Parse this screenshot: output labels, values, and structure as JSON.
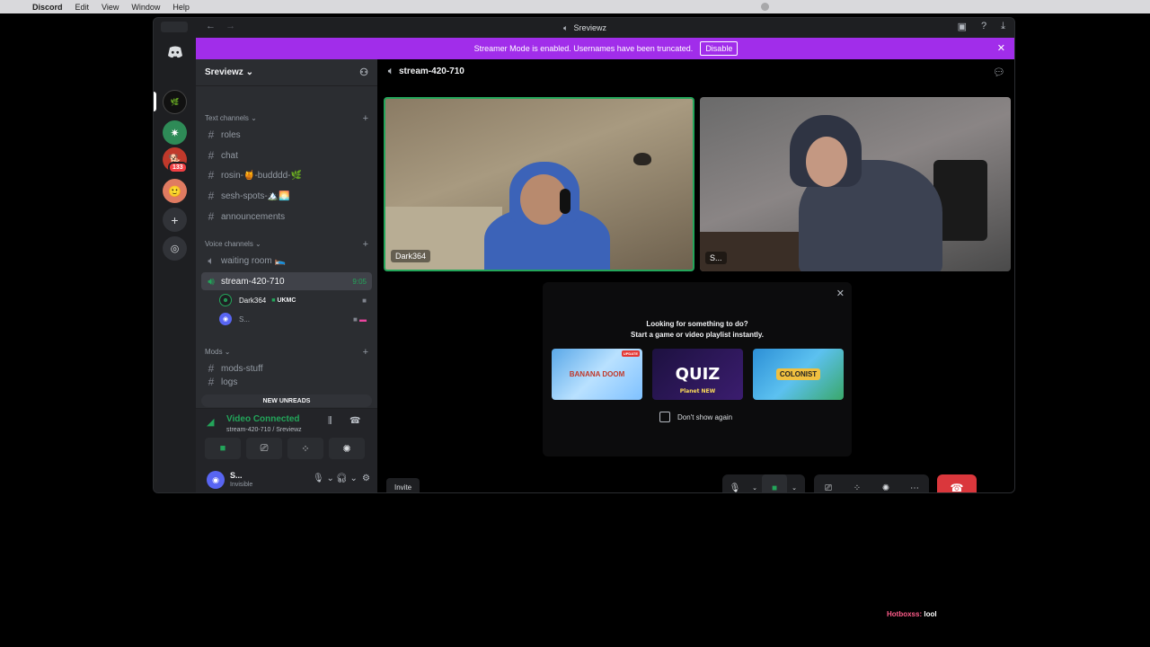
{
  "menubar": {
    "apple": "",
    "app": "Discord",
    "items": [
      "Edit",
      "View",
      "Window",
      "Help"
    ]
  },
  "window": {
    "title": "Sreviewz"
  },
  "banner": {
    "text": "Streamer Mode is enabled. Usernames have been truncated.",
    "button": "Disable",
    "close": "✕"
  },
  "servers": {
    "badge": "133"
  },
  "guild": {
    "name": "Sreviewz ⌄"
  },
  "categories": {
    "text": "Text channels ⌄",
    "voice": "Voice channels ⌄",
    "mods": "Mods ⌄"
  },
  "text_channels": [
    "roles",
    "chat",
    "rosin-🍯-budddd-🌿",
    "sesh-spots-🏔️🌅",
    "announcements"
  ],
  "voice_channels": [
    {
      "name": "waiting room 🛌"
    },
    {
      "name": "stream-420-710",
      "time": "9:05"
    }
  ],
  "members": [
    {
      "name": "Dark364",
      "tag": "UKMC"
    },
    {
      "name": "S..."
    }
  ],
  "mods_channels": [
    "mods-stuff",
    "logs"
  ],
  "new_unreads": "NEW UNREADS",
  "voice_panel": {
    "title": "Video Connected",
    "subtitle": "stream-420-710 / Sreviewz"
  },
  "user": {
    "name": "S...",
    "status": "Invisible"
  },
  "main": {
    "channel": "stream-420-710"
  },
  "tiles": [
    {
      "name": "Dark364"
    },
    {
      "name": "S..."
    }
  ],
  "activity": {
    "line1": "Looking for something to do?",
    "line2": "Start a game or video playlist instantly.",
    "cards": [
      {
        "title": "BANANA DOOM",
        "badge": "UPDATE"
      },
      {
        "title": "QUIZ",
        "sub": "Planet NEW"
      },
      {
        "title": "COLONIST"
      }
    ],
    "dont_show": "Don't show again"
  },
  "invite": "Invite",
  "overlay": {
    "name": "Hotboxss:",
    "msg": "lool"
  },
  "colors": {
    "accent": "#5865f2",
    "green": "#23a55a",
    "red": "#da373c",
    "banner": "#a12dea"
  }
}
